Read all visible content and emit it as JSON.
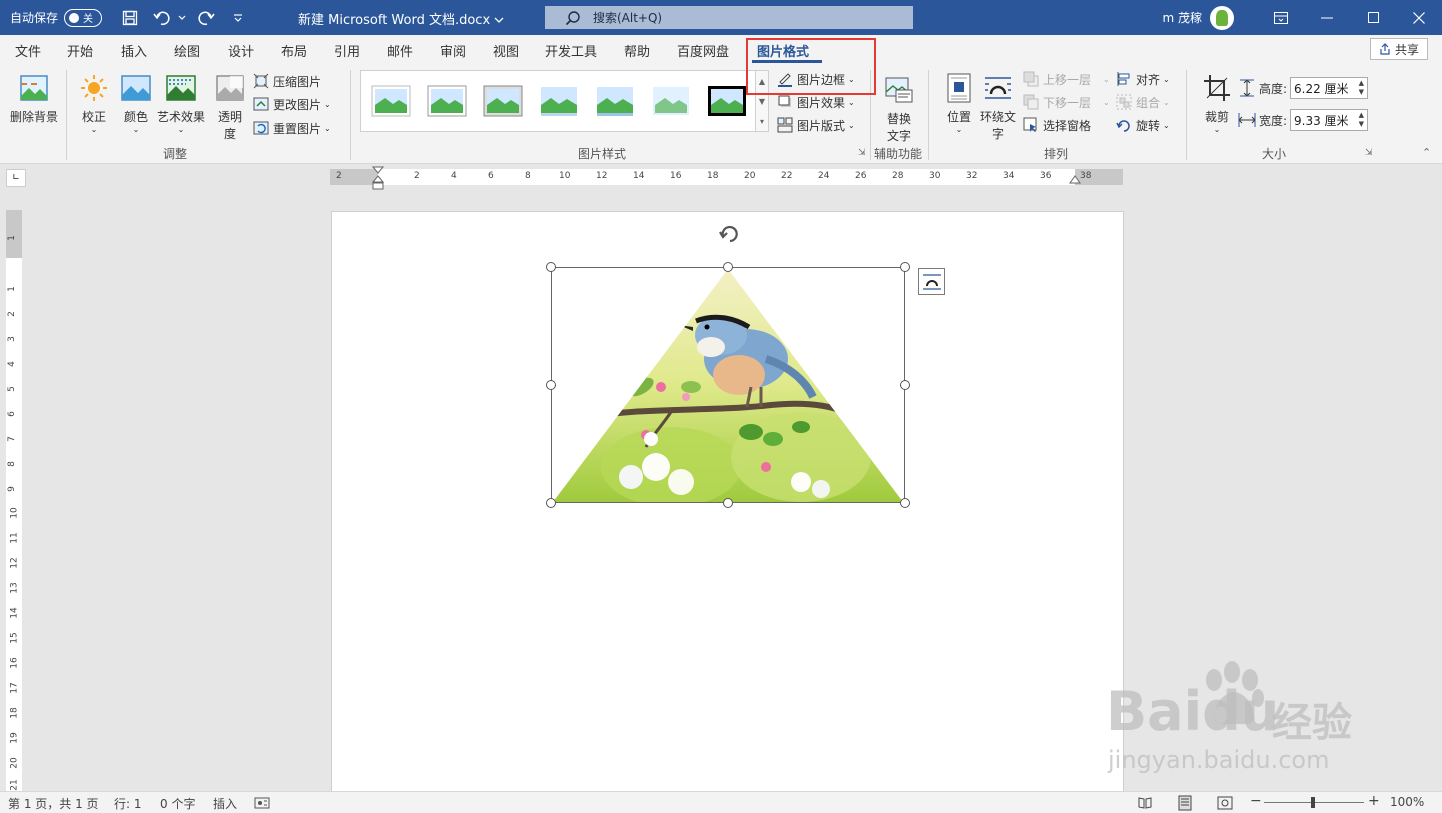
{
  "titlebar": {
    "autosave_label": "自动保存",
    "autosave_state": "关",
    "doc_title": "新建 Microsoft Word 文档.docx",
    "search_placeholder": "搜索(Alt+Q)",
    "user_name": "m 茂稼",
    "bg_color": "#2b579a"
  },
  "menu": {
    "tabs": [
      "文件",
      "开始",
      "插入",
      "绘图",
      "设计",
      "布局",
      "引用",
      "邮件",
      "审阅",
      "视图",
      "开发工具",
      "帮助",
      "百度网盘",
      "图片格式"
    ],
    "active_tab": "图片格式",
    "share_label": "共享"
  },
  "ribbon": {
    "adjust": {
      "remove_bg": "删除背景",
      "corrections": "校正",
      "color": "颜色",
      "artistic": "艺术效果",
      "transparency_1": "透明",
      "transparency_2": "度",
      "compress": "压缩图片",
      "change": "更改图片",
      "reset": "重置图片",
      "group_label": "调整"
    },
    "styles": {
      "border": "图片边框",
      "effects": "图片效果",
      "layout": "图片版式",
      "group_label": "图片样式"
    },
    "accessibility": {
      "alt_text_1": "替换",
      "alt_text_2": "文字",
      "group_label": "辅助功能"
    },
    "arrange": {
      "position": "位置",
      "wrap_1": "环绕文",
      "wrap_2": "字",
      "bring_forward": "上移一层",
      "send_backward": "下移一层",
      "selection_pane": "选择窗格",
      "align": "对齐",
      "group": "组合",
      "rotate": "旋转",
      "group_label": "排列"
    },
    "size": {
      "crop": "裁剪",
      "height_label": "高度:",
      "height_value": "6.22 厘米",
      "width_label": "宽度:",
      "width_value": "9.33 厘米",
      "group_label": "大小"
    }
  },
  "ruler": {
    "h_numbers": [
      "2",
      "2",
      "4",
      "6",
      "8",
      "10",
      "12",
      "14",
      "16",
      "18",
      "20",
      "22",
      "24",
      "26",
      "28",
      "30",
      "32",
      "34",
      "36",
      "38"
    ],
    "v_numbers": [
      "1",
      "1",
      "2",
      "3",
      "4",
      "5",
      "6",
      "7",
      "8",
      "9",
      "10",
      "11",
      "12",
      "13",
      "14",
      "15",
      "16",
      "17",
      "18",
      "19",
      "20",
      "21"
    ]
  },
  "statusbar": {
    "page": "第 1 页，共 1 页",
    "line": "行: 1",
    "words": "0 个字",
    "mode": "插入",
    "zoom": "100%"
  },
  "watermark": {
    "brand": "Baidu",
    "brand_cn": "经验",
    "url": "jingyan.baidu.com"
  }
}
